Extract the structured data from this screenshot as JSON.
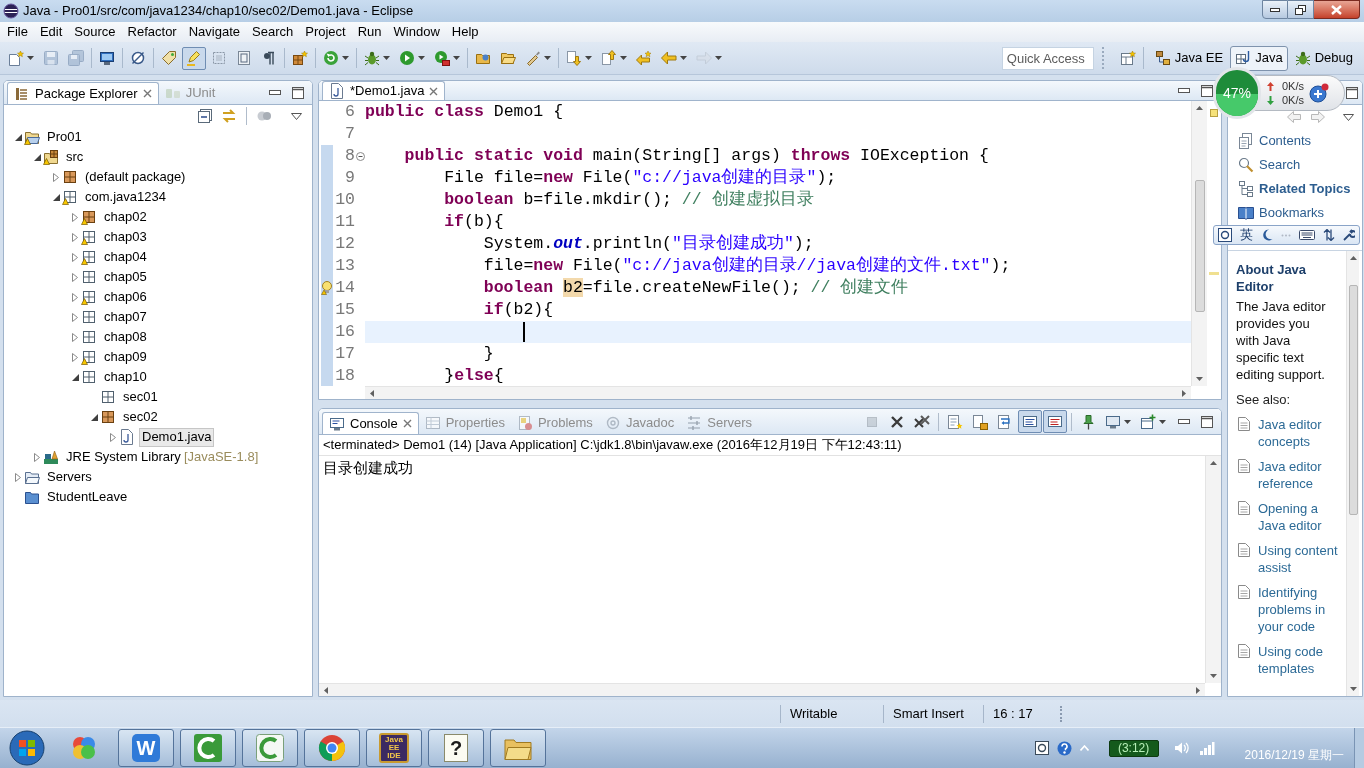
{
  "window": {
    "title": "Java - Pro01/src/com/java1234/chap10/sec02/Demo1.java - Eclipse"
  },
  "menu": [
    "File",
    "Edit",
    "Source",
    "Refactor",
    "Navigate",
    "Search",
    "Project",
    "Run",
    "Window",
    "Help"
  ],
  "toolbar": {
    "groups": [
      [
        {
          "kind": "new",
          "selected": false,
          "disabled": false,
          "dropdown": true
        },
        {
          "kind": "save",
          "selected": false,
          "disabled": true,
          "dropdown": false
        },
        {
          "kind": "save-all",
          "selected": false,
          "disabled": true,
          "dropdown": false
        }
      ],
      [
        {
          "kind": "monitor",
          "selected": false,
          "disabled": false,
          "dropdown": false
        }
      ],
      [
        {
          "kind": "skip-breakpoints",
          "selected": false,
          "disabled": false,
          "dropdown": false
        }
      ],
      [
        {
          "kind": "open-type",
          "selected": false,
          "disabled": false,
          "dropdown": false
        },
        {
          "kind": "highlighter",
          "selected": true,
          "disabled": false,
          "dropdown": false
        },
        {
          "kind": "block-selection",
          "selected": false,
          "disabled": false,
          "dropdown": false
        },
        {
          "kind": "show-source",
          "selected": false,
          "disabled": false,
          "dropdown": false
        },
        {
          "kind": "pilcrow",
          "selected": false,
          "disabled": false,
          "dropdown": false
        }
      ],
      [
        {
          "kind": "new-package",
          "selected": false,
          "disabled": false,
          "dropdown": false
        }
      ],
      [
        {
          "kind": "refresh",
          "selected": false,
          "disabled": false,
          "dropdown": true
        }
      ],
      [
        {
          "kind": "debug",
          "selected": false,
          "disabled": false,
          "dropdown": true
        },
        {
          "kind": "run",
          "selected": false,
          "disabled": false,
          "dropdown": true
        },
        {
          "kind": "external-tools",
          "selected": false,
          "disabled": false,
          "dropdown": true
        }
      ],
      [
        {
          "kind": "open-project",
          "selected": false,
          "disabled": false,
          "dropdown": false
        },
        {
          "kind": "open-folder",
          "selected": false,
          "disabled": false,
          "dropdown": false
        },
        {
          "kind": "brush",
          "selected": false,
          "disabled": false,
          "dropdown": true
        }
      ],
      [
        {
          "kind": "next-annotation",
          "selected": false,
          "disabled": false,
          "dropdown": true
        },
        {
          "kind": "prev-annotation",
          "selected": false,
          "disabled": false,
          "dropdown": true
        },
        {
          "kind": "last-edit",
          "selected": false,
          "disabled": false,
          "dropdown": false
        },
        {
          "kind": "back",
          "selected": false,
          "disabled": false,
          "dropdown": true
        },
        {
          "kind": "forward",
          "selected": false,
          "disabled": true,
          "dropdown": true
        }
      ]
    ],
    "quick_access": {
      "placeholder": "Quick Access"
    },
    "perspectives": [
      {
        "kind": "java-ee",
        "label": "Java EE",
        "selected": false
      },
      {
        "kind": "java",
        "label": "Java",
        "selected": true
      },
      {
        "kind": "debug",
        "label": "Debug",
        "selected": false
      }
    ]
  },
  "speed_widget": {
    "percent": "47%",
    "level": 0.47,
    "upload": "0K/s",
    "download": "0K/s"
  },
  "package_explorer": {
    "tabs": [
      {
        "kind": "package-explorer",
        "label": "Package Explorer",
        "selected": true
      },
      {
        "kind": "junit",
        "label": "JUnit",
        "selected": false
      }
    ],
    "tree": [
      {
        "label": "Pro01",
        "kind": "project",
        "warning": true,
        "expanded": true,
        "selected": false,
        "children": [
          {
            "label": "src",
            "kind": "source-folder",
            "warning": true,
            "expanded": true,
            "selected": false,
            "children": [
              {
                "label": "(default package)",
                "kind": "package",
                "warning": false,
                "expanded": false,
                "selected": false
              },
              {
                "label": "com.java1234",
                "kind": "empty-package",
                "warning": true,
                "expanded": true,
                "selected": false,
                "children": [
                  {
                    "label": "chap02",
                    "kind": "package",
                    "warning": true,
                    "expanded": false,
                    "selected": false
                  },
                  {
                    "label": "chap03",
                    "kind": "empty-package",
                    "warning": true,
                    "expanded": false,
                    "selected": false
                  },
                  {
                    "label": "chap04",
                    "kind": "empty-package",
                    "warning": true,
                    "expanded": false,
                    "selected": false
                  },
                  {
                    "label": "chap05",
                    "kind": "empty-package",
                    "warning": false,
                    "expanded": false,
                    "selected": false
                  },
                  {
                    "label": "chap06",
                    "kind": "empty-package",
                    "warning": true,
                    "expanded": false,
                    "selected": false
                  },
                  {
                    "label": "chap07",
                    "kind": "empty-package",
                    "warning": false,
                    "expanded": false,
                    "selected": false
                  },
                  {
                    "label": "chap08",
                    "kind": "empty-package",
                    "warning": false,
                    "expanded": false,
                    "selected": false
                  },
                  {
                    "label": "chap09",
                    "kind": "empty-package",
                    "warning": true,
                    "expanded": false,
                    "selected": false
                  },
                  {
                    "label": "chap10",
                    "kind": "empty-package",
                    "warning": false,
                    "expanded": true,
                    "selected": false,
                    "children": [
                      {
                        "label": "sec01",
                        "kind": "empty-package",
                        "warning": false,
                        "selected": false
                      },
                      {
                        "label": "sec02",
                        "kind": "package",
                        "warning": false,
                        "expanded": true,
                        "selected": false,
                        "children": [
                          {
                            "label": "Demo1.java",
                            "kind": "java-file",
                            "warning": false,
                            "expanded": false,
                            "selected": true
                          }
                        ]
                      }
                    ]
                  }
                ]
              }
            ]
          },
          {
            "label": "JRE System Library",
            "decoration": "[JavaSE-1.8]",
            "kind": "library",
            "warning": false,
            "expanded": false,
            "selected": false
          }
        ]
      },
      {
        "label": "Servers",
        "kind": "folder",
        "warning": false,
        "expanded": false,
        "selected": false
      },
      {
        "label": "StudentLeave",
        "kind": "closed-project",
        "warning": false,
        "selected": false
      }
    ]
  },
  "editor": {
    "tabs": [
      {
        "label": "*Demo1.java",
        "selected": true
      }
    ],
    "lines": [
      {
        "number": "6",
        "changed": false,
        "tokens": [
          {
            "kind": "keyword",
            "text": "public class"
          },
          {
            "kind": "plain",
            "text": " Demo1 {"
          }
        ]
      },
      {
        "number": "7",
        "changed": false
      },
      {
        "number": "8",
        "changed": true,
        "fold": true,
        "tokens": [
          {
            "kind": "keyword",
            "text": "    public static void"
          },
          {
            "kind": "plain",
            "text": " main(String[] args) "
          },
          {
            "kind": "keyword",
            "text": "throws"
          },
          {
            "kind": "plain",
            "text": " IOException {"
          }
        ]
      },
      {
        "number": "9",
        "changed": true,
        "tokens": [
          {
            "kind": "plain",
            "text": "        File file="
          },
          {
            "kind": "keyword",
            "text": "new"
          },
          {
            "kind": "plain",
            "text": " File("
          },
          {
            "kind": "string",
            "text": "\"c://java创建的目录\""
          },
          {
            "kind": "plain",
            "text": ");"
          }
        ]
      },
      {
        "number": "10",
        "changed": true,
        "tokens": [
          {
            "kind": "keyword",
            "text": "        boolean"
          },
          {
            "kind": "plain",
            "text": " b=file.mkdir(); "
          },
          {
            "kind": "comment",
            "text": "// 创建虚拟目录"
          }
        ]
      },
      {
        "number": "11",
        "changed": true,
        "tokens": [
          {
            "kind": "keyword",
            "text": "        if"
          },
          {
            "kind": "plain",
            "text": "(b){"
          }
        ]
      },
      {
        "number": "12",
        "changed": true,
        "tokens": [
          {
            "kind": "plain",
            "text": "            System."
          },
          {
            "kind": "field",
            "text": "out"
          },
          {
            "kind": "plain",
            "text": ".println("
          },
          {
            "kind": "string",
            "text": "\"目录创建成功\""
          },
          {
            "kind": "plain",
            "text": ");"
          }
        ]
      },
      {
        "number": "13",
        "changed": true,
        "tokens": [
          {
            "kind": "plain",
            "text": "            file="
          },
          {
            "kind": "keyword",
            "text": "new"
          },
          {
            "kind": "plain",
            "text": " File("
          },
          {
            "kind": "string",
            "text": "\"c://java创建的目录//java创建的文件.txt\""
          },
          {
            "kind": "plain",
            "text": ");"
          }
        ]
      },
      {
        "number": "14",
        "changed": true,
        "warning": true,
        "tokens": [
          {
            "kind": "keyword",
            "text": "            boolean "
          },
          {
            "kind": "occurrence",
            "text": "b2"
          },
          {
            "kind": "plain",
            "text": "=file.createNewFile(); "
          },
          {
            "kind": "comment",
            "text": "// 创建文件"
          }
        ]
      },
      {
        "number": "15",
        "changed": true,
        "tokens": [
          {
            "kind": "keyword",
            "text": "            if"
          },
          {
            "kind": "plain",
            "text": "(b2){"
          }
        ]
      },
      {
        "number": "16",
        "changed": true,
        "current": true,
        "cursor": true
      },
      {
        "number": "17",
        "changed": true,
        "tokens": [
          {
            "kind": "plain",
            "text": "            }"
          }
        ]
      },
      {
        "number": "18",
        "changed": true,
        "tokens": [
          {
            "kind": "plain",
            "text": "        }"
          },
          {
            "kind": "keyword",
            "text": "else"
          },
          {
            "kind": "plain",
            "text": "{"
          }
        ]
      }
    ]
  },
  "console": {
    "tabs": [
      {
        "kind": "console",
        "label": "Console",
        "selected": true
      },
      {
        "kind": "properties",
        "label": "Properties",
        "selected": false
      },
      {
        "kind": "problems",
        "label": "Problems",
        "selected": false
      },
      {
        "kind": "javadoc",
        "label": "Javadoc",
        "selected": false
      },
      {
        "kind": "servers",
        "label": "Servers",
        "selected": false
      }
    ],
    "toolbar": [
      [
        {
          "kind": "terminate",
          "selected": false,
          "disabled": true,
          "dropdown": false
        },
        {
          "kind": "remove-launch",
          "selected": false,
          "disabled": false,
          "dropdown": false
        },
        {
          "kind": "remove-all",
          "selected": false,
          "disabled": false,
          "dropdown": false
        }
      ],
      [
        {
          "kind": "clear",
          "selected": false,
          "disabled": false,
          "dropdown": false
        },
        {
          "kind": "scroll-lock",
          "selected": false,
          "disabled": false,
          "dropdown": false
        },
        {
          "kind": "word-wrap",
          "selected": false,
          "disabled": false,
          "dropdown": false
        },
        {
          "kind": "show-on-output",
          "selected": true,
          "disabled": false,
          "dropdown": false
        },
        {
          "kind": "show-on-error",
          "selected": true,
          "disabled": false,
          "dropdown": false
        }
      ],
      [
        {
          "kind": "pin",
          "selected": false,
          "disabled": false,
          "dropdown": false
        },
        {
          "kind": "display-console",
          "selected": false,
          "disabled": false,
          "dropdown": true
        },
        {
          "kind": "open-console",
          "selected": false,
          "disabled": false,
          "dropdown": true
        }
      ]
    ],
    "description": "<terminated> Demo1 (14) [Java Application] C:\\jdk1.8\\bin\\javaw.exe (2016年12月19日 下午12:43:11)",
    "output": [
      "目录创建成功"
    ]
  },
  "help": {
    "nav": [
      {
        "kind": "contents",
        "label": "Contents",
        "selected": false
      },
      {
        "kind": "search",
        "label": "Search",
        "selected": false
      },
      {
        "kind": "related",
        "label": "Related Topics",
        "selected": true
      },
      {
        "kind": "bookmarks",
        "label": "Bookmarks",
        "selected": false
      }
    ],
    "heading": "About Java Editor",
    "body": "The Java editor provides you with Java specific text editing support.",
    "see_also": "See also:",
    "links": [
      "Java editor concepts",
      "Java editor reference",
      "Opening a Java editor",
      "Using content assist",
      "Identifying problems in your code",
      "Using code templates"
    ]
  },
  "ime_bar": {
    "language": "英"
  },
  "status_bar": {
    "fields": [
      "Writable",
      "Smart Insert",
      "16 : 17"
    ]
  },
  "taskbar": {
    "apps": [
      {
        "kind": "circles",
        "running": false
      },
      {
        "kind": "letter",
        "glyph": "W",
        "running": true
      },
      {
        "kind": "arc",
        "running": true
      },
      {
        "kind": "arc-light",
        "running": true
      },
      {
        "kind": "browser",
        "running": true
      },
      {
        "kind": "ide",
        "glyph": "Java EE IDE",
        "running": true
      },
      {
        "kind": "help",
        "glyph": "?",
        "running": true
      },
      {
        "kind": "folder",
        "running": true
      }
    ],
    "battery": "(3:12)",
    "date": "2016/12/19 星期一"
  }
}
